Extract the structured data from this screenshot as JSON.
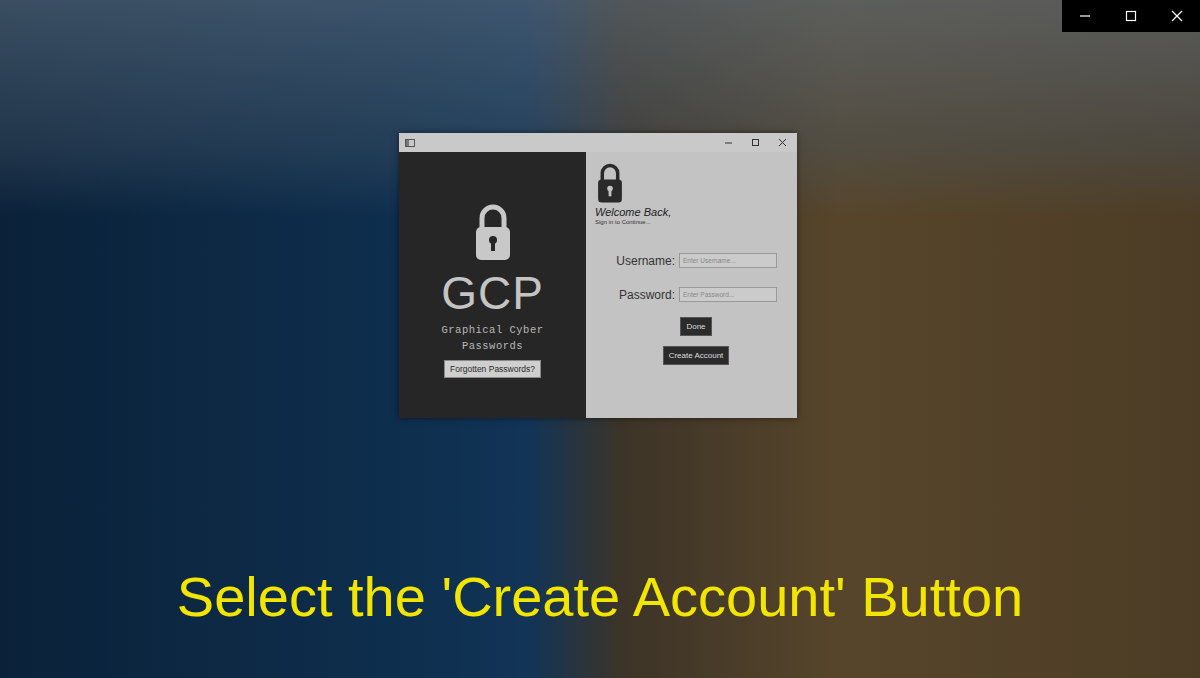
{
  "app": {
    "brand": {
      "title": "GCP",
      "subtitle": "Graphical Cyber Passwords"
    },
    "forgot_button": "Forgotten Passwords?",
    "welcome": "Welcome Back,",
    "welcome_sub": "Sign in to Continue...",
    "fields": [
      {
        "label": "Username:",
        "placeholder": "Enter Username..."
      },
      {
        "label": "Password:",
        "placeholder": "Enter Password..."
      }
    ],
    "buttons": [
      {
        "label": "Done"
      },
      {
        "label": "Create Account"
      }
    ]
  },
  "caption": "Select the 'Create Account' Button"
}
